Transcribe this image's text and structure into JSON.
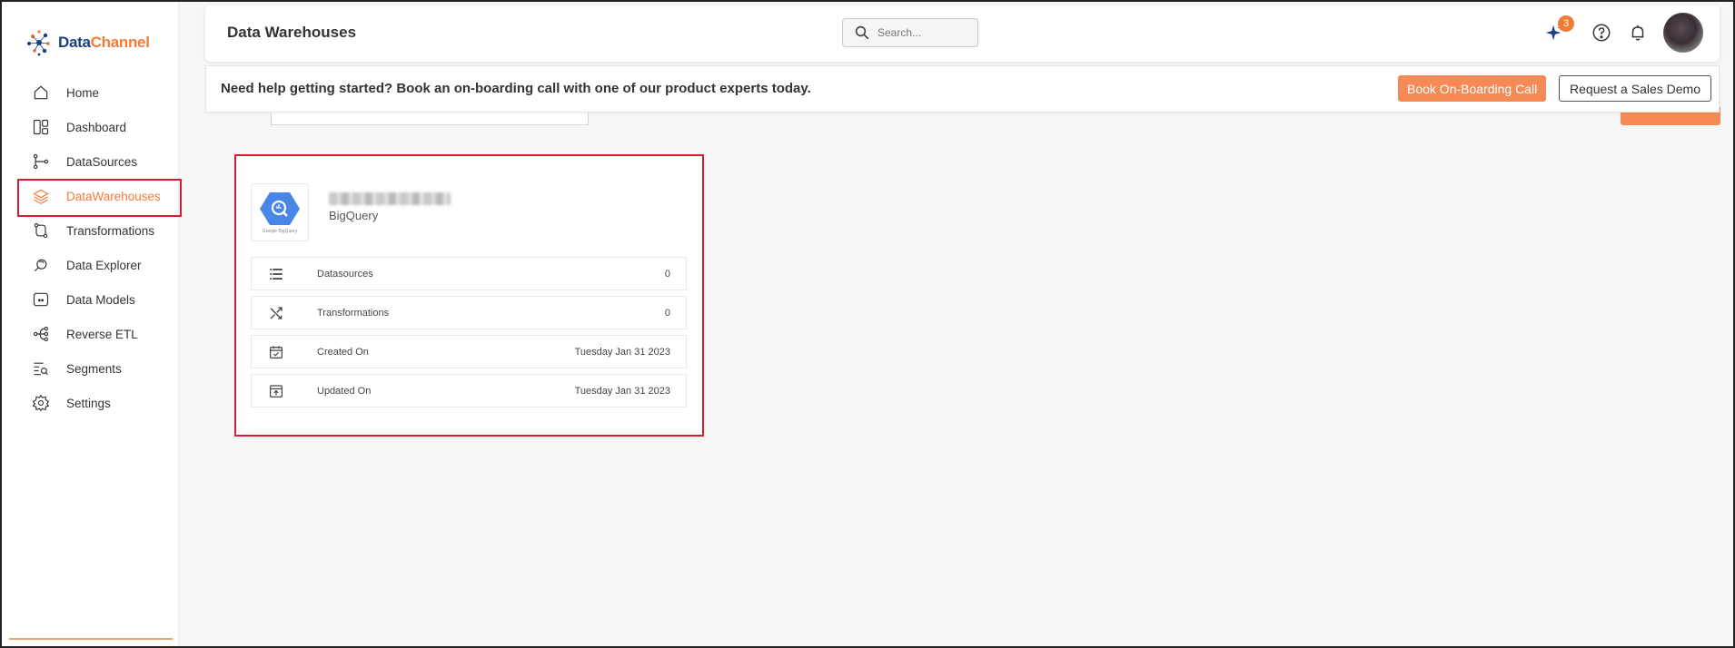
{
  "brand": {
    "name_part1": "Data",
    "name_part2": "Channel"
  },
  "sidebar": {
    "items": [
      {
        "label": "Home",
        "icon": "home-icon"
      },
      {
        "label": "Dashboard",
        "icon": "dashboard-icon"
      },
      {
        "label": "DataSources",
        "icon": "datasources-icon"
      },
      {
        "label": "DataWarehouses",
        "icon": "layers-icon",
        "active": true
      },
      {
        "label": "Transformations",
        "icon": "transformations-icon"
      },
      {
        "label": "Data Explorer",
        "icon": "explorer-icon"
      },
      {
        "label": "Data Models",
        "icon": "models-icon"
      },
      {
        "label": "Reverse ETL",
        "icon": "reverse-etl-icon"
      },
      {
        "label": "Segments",
        "icon": "segments-icon"
      },
      {
        "label": "Settings",
        "icon": "gear-icon"
      }
    ]
  },
  "header": {
    "title": "Data Warehouses",
    "search_placeholder": "Search...",
    "notification_count": "3"
  },
  "banner": {
    "text": "Need help getting started? Book an on-boarding call with one of our product experts today.",
    "primary_button": "Book On-Boarding Call",
    "secondary_button": "Request a Sales Demo"
  },
  "card": {
    "type": "BigQuery",
    "logo_caption": "Google BigQuery",
    "stats": [
      {
        "label": "Datasources",
        "value": "0",
        "icon": "list-icon"
      },
      {
        "label": "Transformations",
        "value": "0",
        "icon": "shuffle-icon"
      },
      {
        "label": "Created On",
        "value": "Tuesday Jan 31 2023",
        "icon": "calendar-check-icon"
      },
      {
        "label": "Updated On",
        "value": "Tuesday Jan 31 2023",
        "icon": "update-icon"
      }
    ]
  },
  "colors": {
    "accent": "#f47b35",
    "button": "#f58a57",
    "highlight_border": "#d3202f",
    "brand_blue": "#1c3f80"
  }
}
